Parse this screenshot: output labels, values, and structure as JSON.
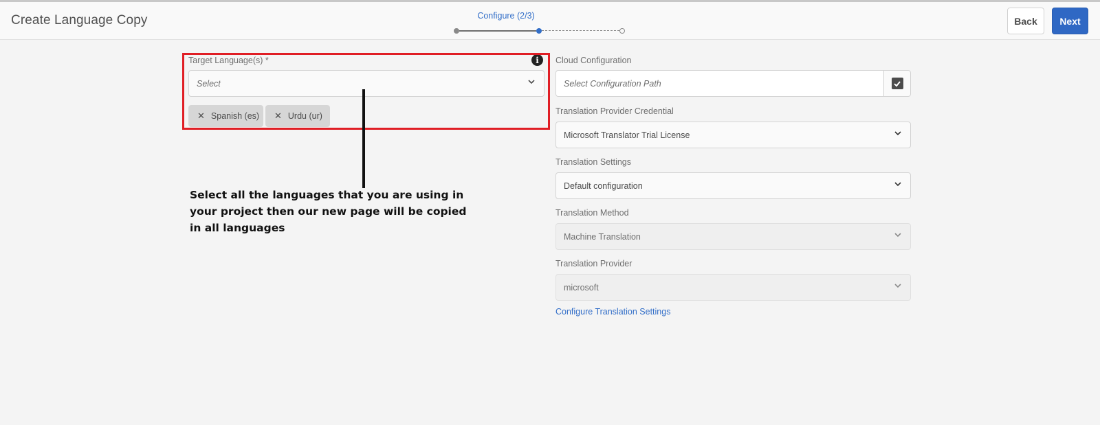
{
  "header": {
    "title": "Create Language Copy",
    "wizard_step_label": "Configure (2/3)",
    "back_label": "Back",
    "next_label": "Next"
  },
  "target_languages": {
    "label": "Target Language(s) *",
    "placeholder": "Select",
    "tags": [
      {
        "label": "Spanish (es)"
      },
      {
        "label": "Urdu (ur)"
      }
    ]
  },
  "annotation": {
    "text": "Select all the languages that you are using in your project then our new page will be copied in all languages"
  },
  "cloud_configuration": {
    "label": "Cloud Configuration",
    "placeholder": "Select Configuration Path"
  },
  "translation_provider_credential": {
    "label": "Translation Provider Credential",
    "value": "Microsoft Translator Trial License"
  },
  "translation_settings": {
    "label": "Translation Settings",
    "value": "Default configuration"
  },
  "translation_method": {
    "label": "Translation Method",
    "value": "Machine Translation"
  },
  "translation_provider": {
    "label": "Translation Provider",
    "value": "microsoft"
  },
  "configure_link": "Configure Translation Settings",
  "colors": {
    "accent": "#326ec8",
    "primary_button": "#2f68c4",
    "annotation_frame": "#e01e25"
  },
  "icons": [
    "info-icon",
    "chevron-down-icon",
    "close-icon",
    "checkbox-checked-icon"
  ]
}
